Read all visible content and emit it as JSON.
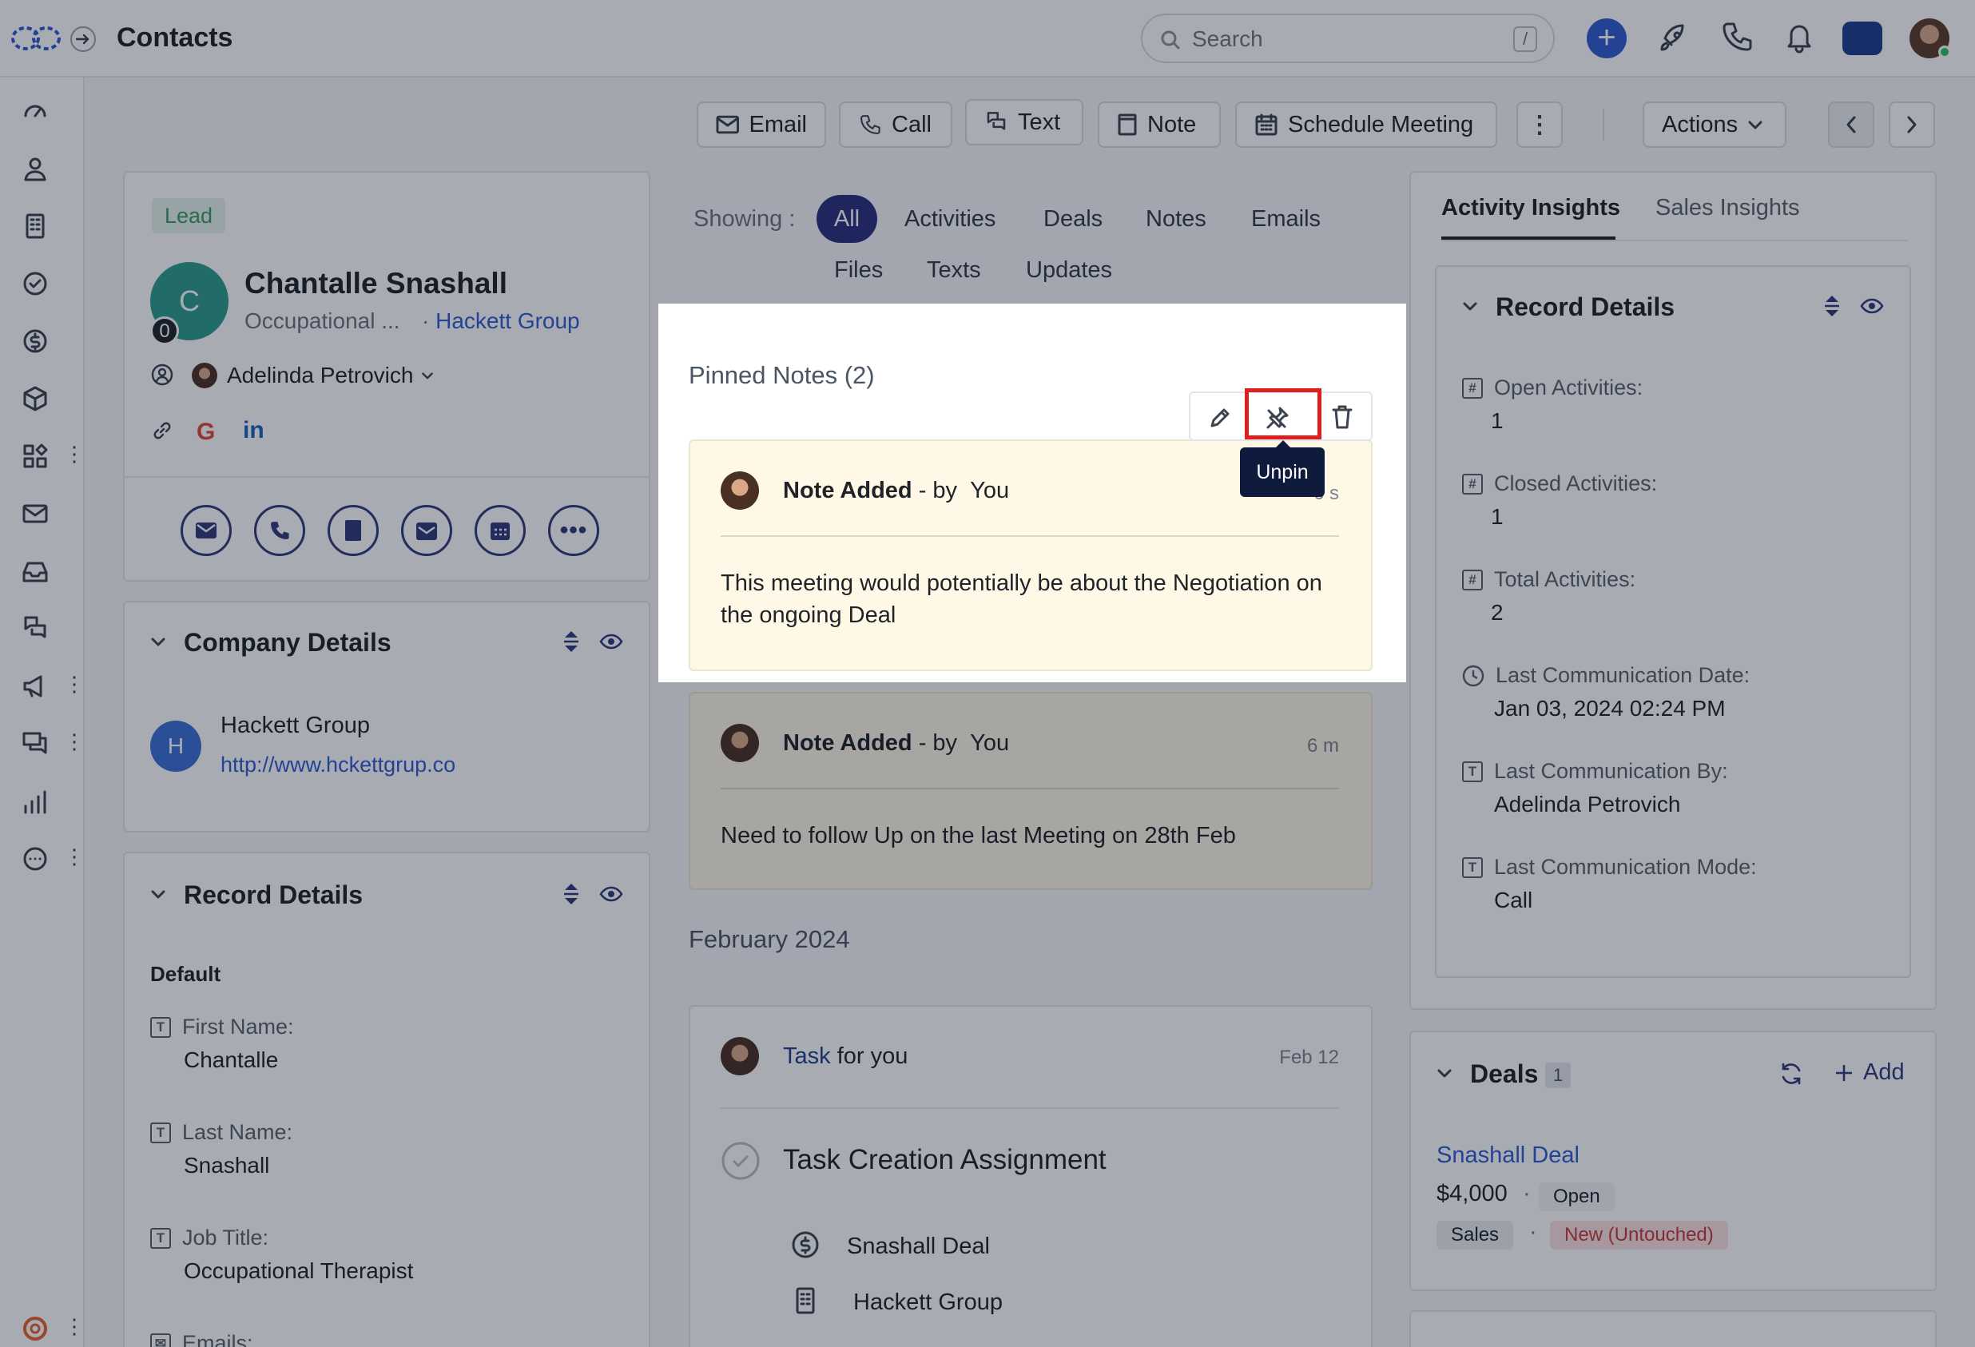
{
  "header": {
    "title": "Contacts",
    "search_placeholder": "Search",
    "search_shortcut": "/"
  },
  "toolbar": {
    "email": "Email",
    "call": "Call",
    "text": "Text",
    "note": "Note",
    "schedule": "Schedule Meeting",
    "actions": "Actions"
  },
  "contact": {
    "badge": "Lead",
    "initial": "C",
    "count": "0",
    "name": "Chantalle Snashall",
    "job": "Occupational ...",
    "company": "Hackett Group",
    "owner": "Adelinda Petrovich"
  },
  "company_details": {
    "title": "Company Details",
    "initial": "H",
    "name": "Hackett Group",
    "url": "http://www.hckettgrup.co"
  },
  "record_details_left": {
    "title": "Record Details",
    "section": "Default",
    "fields": [
      {
        "label": "First Name:",
        "value": "Chantalle"
      },
      {
        "label": "Last Name:",
        "value": "Snashall"
      },
      {
        "label": "Job Title:",
        "value": "Occupational Therapist"
      },
      {
        "label": "Emails:",
        "value": ""
      }
    ]
  },
  "filters": {
    "showing": "Showing :",
    "all": "All",
    "activities": "Activities",
    "deals": "Deals",
    "notes": "Notes",
    "emails": "Emails",
    "files": "Files",
    "texts": "Texts",
    "updates": "Updates"
  },
  "pinned": {
    "title": "Pinned Notes (2)",
    "tooltip": "Unpin",
    "notes": [
      {
        "title": "Note Added",
        "by": "- by",
        "author": "You",
        "time": "6 s",
        "body": "This meeting would potentially be about the Negotiation on the ongoing Deal"
      },
      {
        "title": "Note Added",
        "by": "- by",
        "author": "You",
        "time": "6 m",
        "body": "Need to follow Up on the last Meeting on 28th Feb"
      }
    ]
  },
  "timeline": {
    "month": "February 2024",
    "task_label": "Task",
    "task_for": "for you",
    "task_date": "Feb 12",
    "task_title": "Task Creation Assignment",
    "task_deal": "Snashall Deal",
    "task_company": "Hackett Group"
  },
  "insights": {
    "tab_activity": "Activity Insights",
    "tab_sales": "Sales Insights",
    "title": "Record Details",
    "fields": [
      {
        "label": "Open Activities:",
        "value": "1"
      },
      {
        "label": "Closed Activities:",
        "value": "1"
      },
      {
        "label": "Total Activities:",
        "value": "2"
      },
      {
        "label": "Last Communication Date:",
        "value": "Jan 03, 2024 02:24 PM"
      },
      {
        "label": "Last Communication By:",
        "value": "Adelinda Petrovich"
      },
      {
        "label": "Last Communication Mode:",
        "value": "Call"
      }
    ]
  },
  "deals": {
    "title": "Deals",
    "count": "1",
    "add": "Add",
    "deal_name": "Snashall Deal",
    "amount": "$4,000",
    "status": "Open",
    "pipeline": "Sales",
    "stage": "New (Untouched)"
  },
  "colors": {
    "accent": "#2f5bd1",
    "highlight": "#e11d1d",
    "note_bg": "#fff8e6"
  }
}
